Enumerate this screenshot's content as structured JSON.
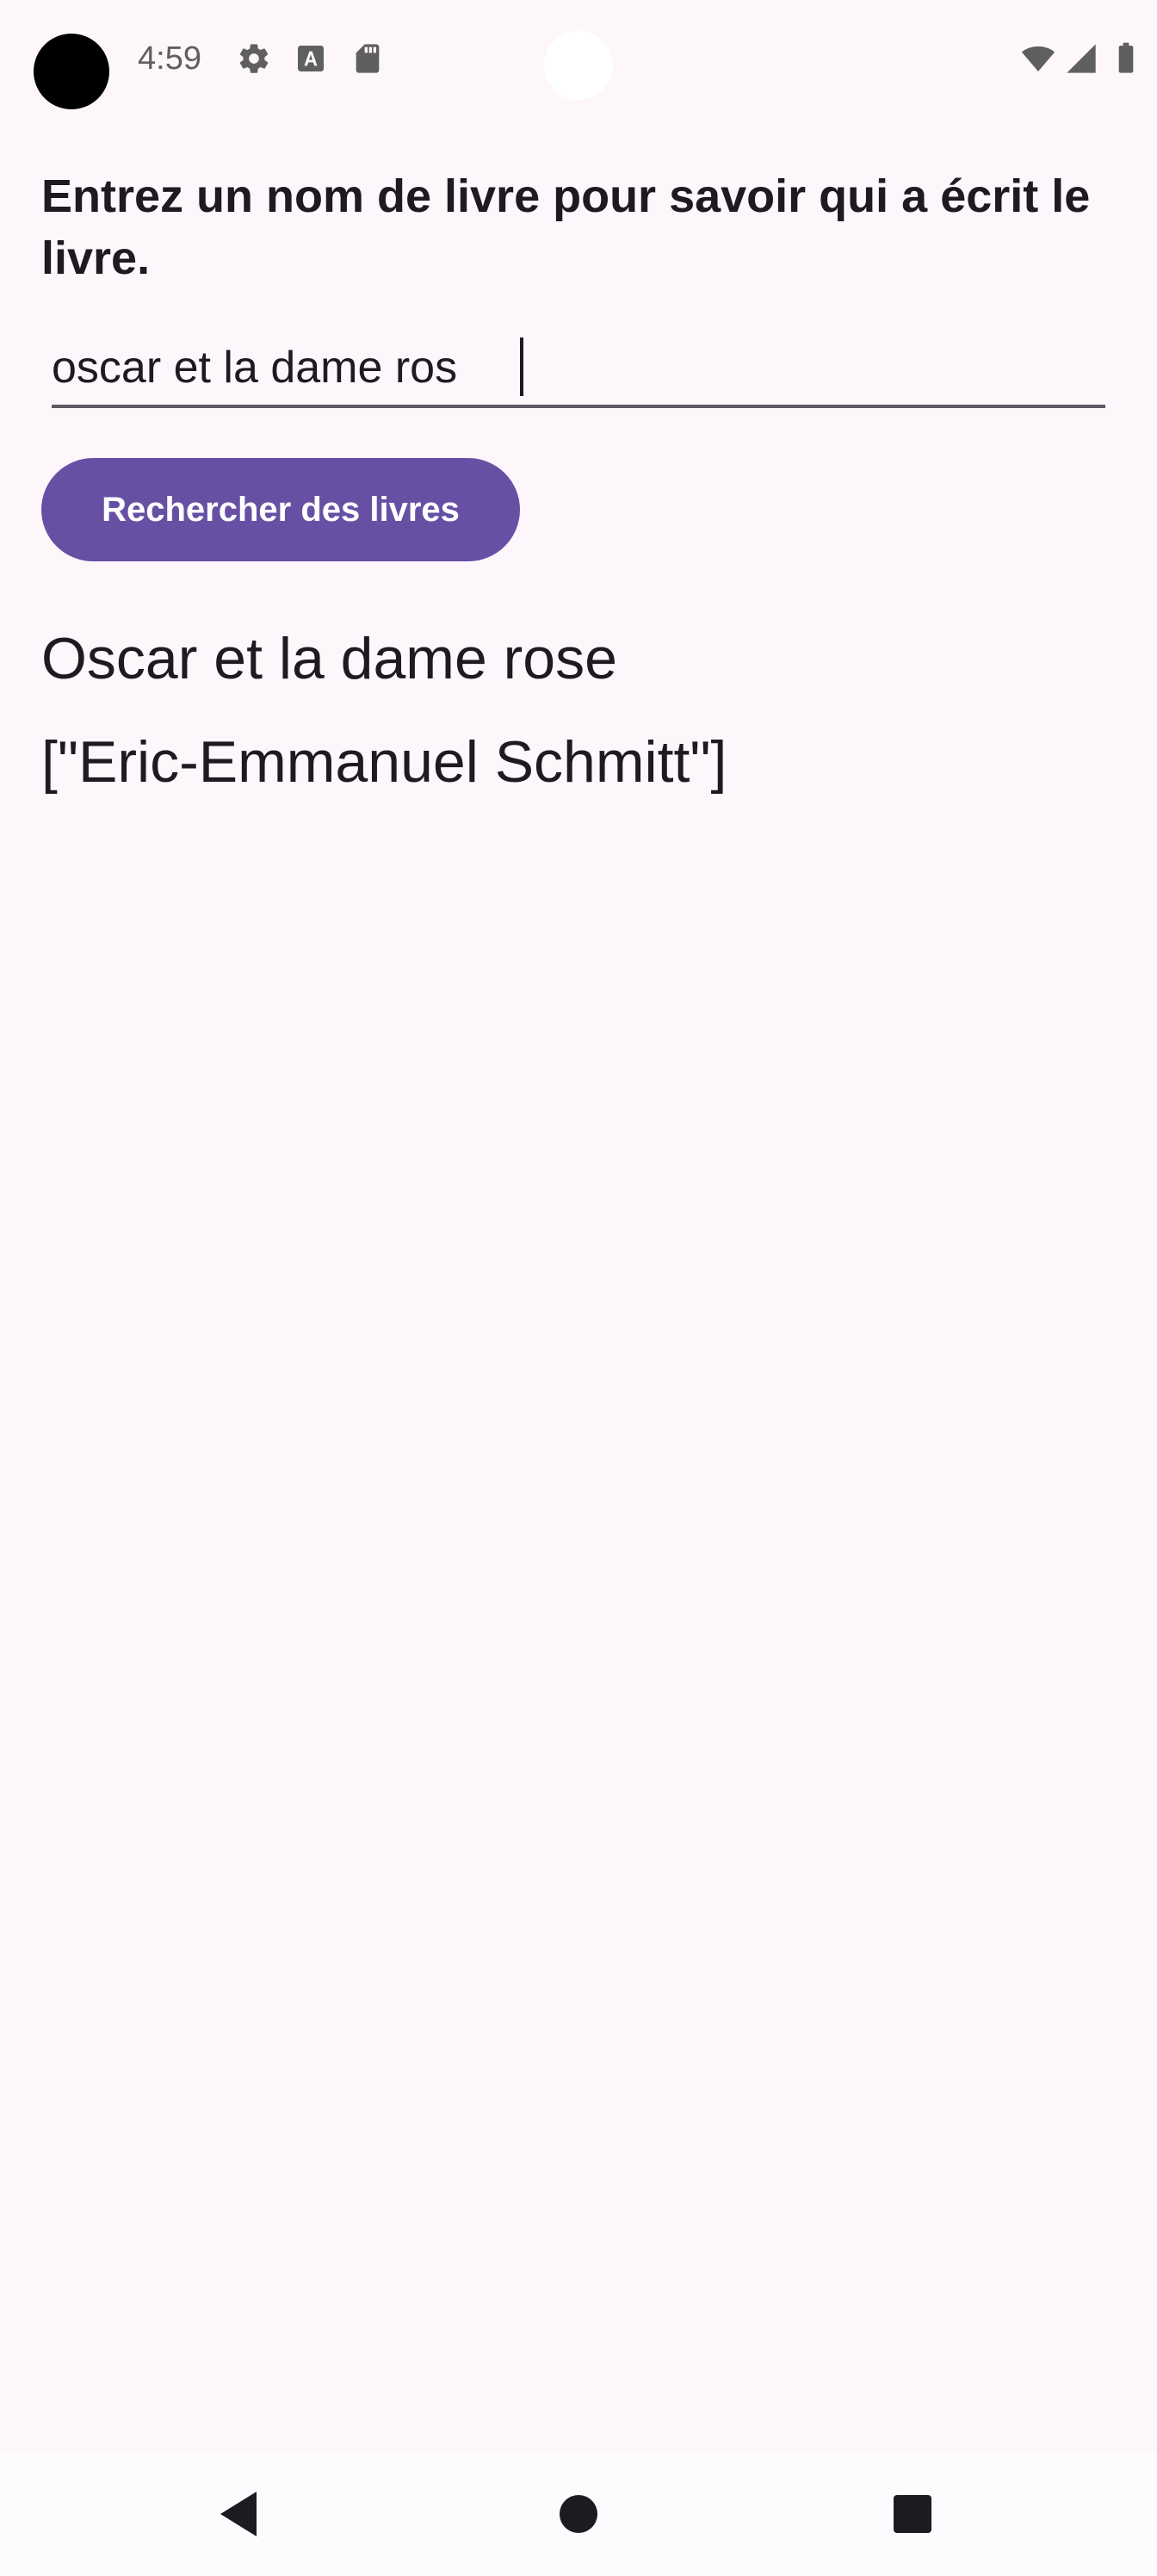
{
  "status_bar": {
    "time": "4:59",
    "icons": [
      "settings-icon",
      "font-a-icon",
      "sd-card-icon",
      "wifi-icon",
      "signal-icon",
      "battery-icon"
    ]
  },
  "main": {
    "prompt": "Entrez un nom de livre pour savoir qui a écrit le livre.",
    "search_value": "oscar et la dame ros",
    "search_button_label": "Rechercher des livres",
    "result_title": "Oscar et la dame rose",
    "result_author": "[\"Eric-Emmanuel Schmitt\"]"
  },
  "nav_bar": {
    "buttons": [
      "back-icon",
      "home-icon",
      "recents-icon"
    ]
  },
  "colors": {
    "background": "#fdf7fc",
    "accent": "#6750a4",
    "text": "#1d1b20",
    "status_icons": "#5f5f5f"
  }
}
